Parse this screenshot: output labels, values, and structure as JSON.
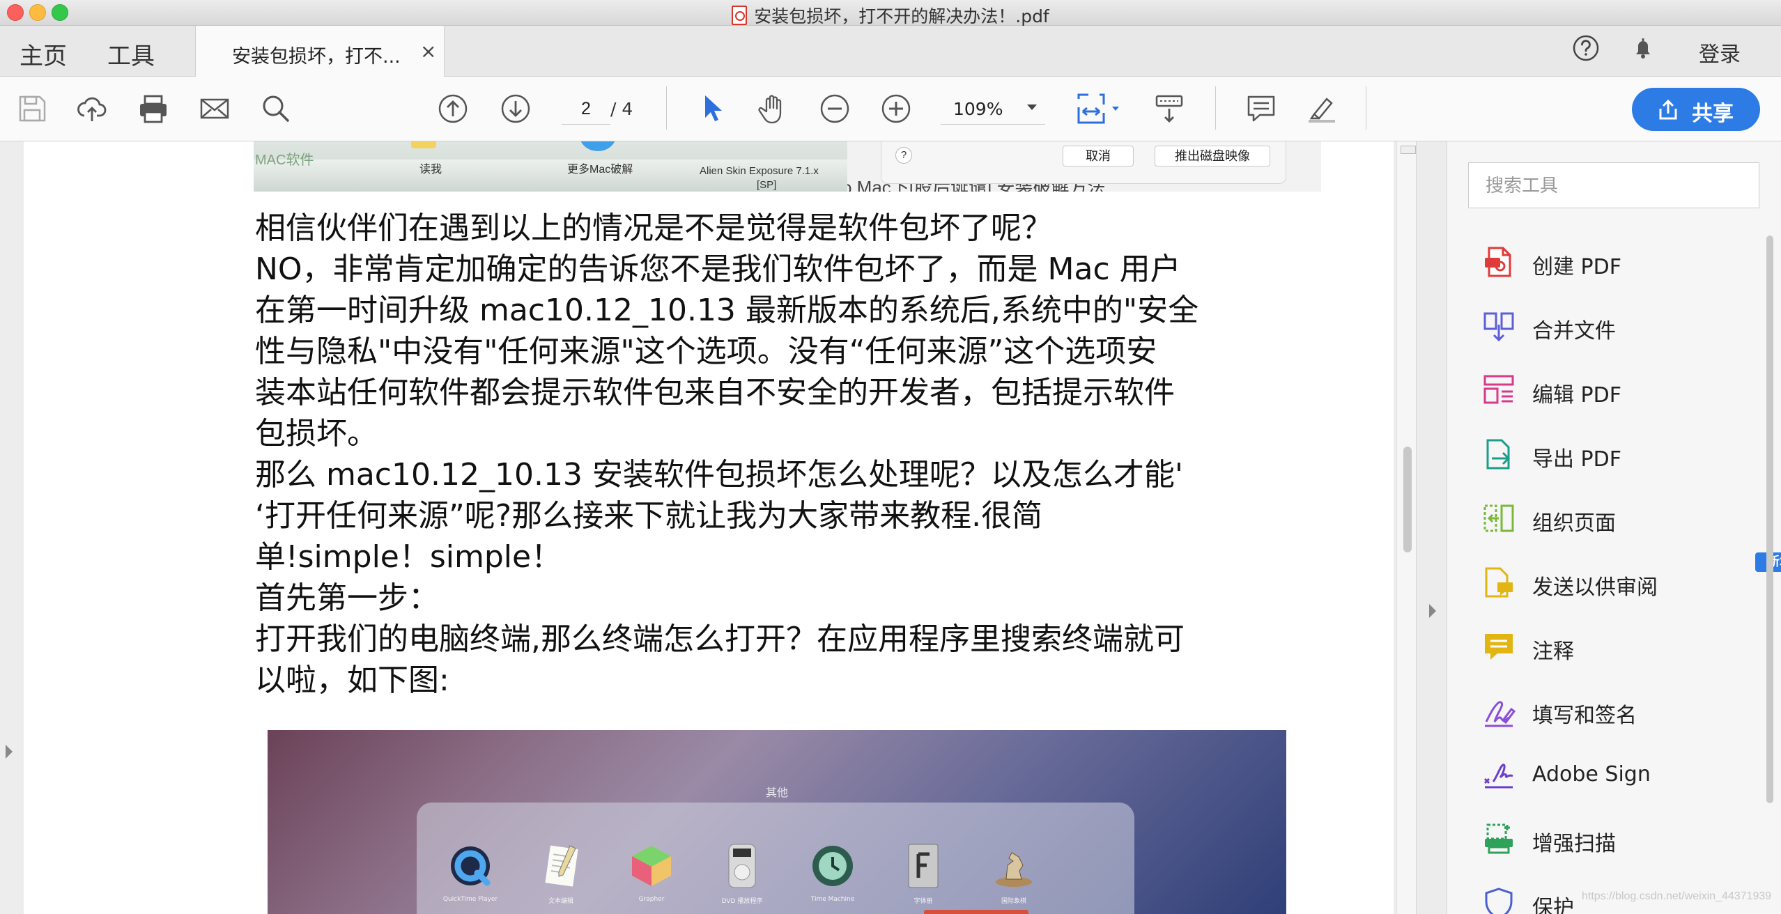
{
  "window": {
    "title": "安装包损坏，打不开的解决办法！.pdf"
  },
  "tabs": {
    "home": "主页",
    "tools": "工具",
    "document": "安装包损坏，打不...",
    "close": "×"
  },
  "header": {
    "login": "登录"
  },
  "toolbar": {
    "page_current": "2",
    "page_total": "/ 4",
    "zoom": "109%",
    "share": "共享"
  },
  "document": {
    "top_image": {
      "left_caption_1": "MAC软件",
      "left_caption_2": "读我",
      "left_caption_3": "更多Mac破解",
      "left_caption_4": "Alien Skin Exposure 7.1.x",
      "left_caption_5": "[SP]",
      "dialog_help": "?",
      "dialog_cancel": "取消",
      "dialog_eject": "推出磁盘映像",
      "behind_text": "o Mac下[股后诞谴]   安装破解方法"
    },
    "lines": [
      "相信伙伴们在遇到以上的情况是不是觉得是软件包坏了呢？",
      "NO，非常肯定加确定的告诉您不是我们软件包坏了，而是 Mac 用户",
      "在第一时间升级 mac10.12_10.13 最新版本的系统后,系统中的\"安全",
      "性与隐私\"中没有\"任何来源\"这个选项。没有“任何来源”这个选项安",
      "装本站任何软件都会提示软件包来自不安全的开发者，包括提示软件",
      "包损坏。",
      "那么 mac10.12_10.13 安装软件包损坏怎么处理呢？以及怎么才能'",
      "‘打开任何来源”呢?那么接来下就让我为大家带来教程.很简",
      "单!simple！simple！",
      "首先第一步：",
      "打开我们的电脑终端,那么终端怎么打开？在应用程序里搜索终端就可",
      "以啦，如下图:"
    ],
    "launchpad": {
      "folder_title": "其他",
      "apps": [
        "QuickTime Player",
        "文本编辑",
        "Grapher",
        "DVD 播放程序",
        "Time Machine",
        "字体册",
        "国际象棋"
      ]
    }
  },
  "right_panel": {
    "search_placeholder": "搜索工具",
    "new_badge": "新增",
    "tools": [
      "创建 PDF",
      "合并文件",
      "编辑 PDF",
      "导出 PDF",
      "组织页面",
      "发送以供审阅",
      "注释",
      "填写和签名",
      "Adobe Sign",
      "增强扫描",
      "保护"
    ]
  },
  "watermark": "https://blog.csdn.net/weixin_44371939"
}
